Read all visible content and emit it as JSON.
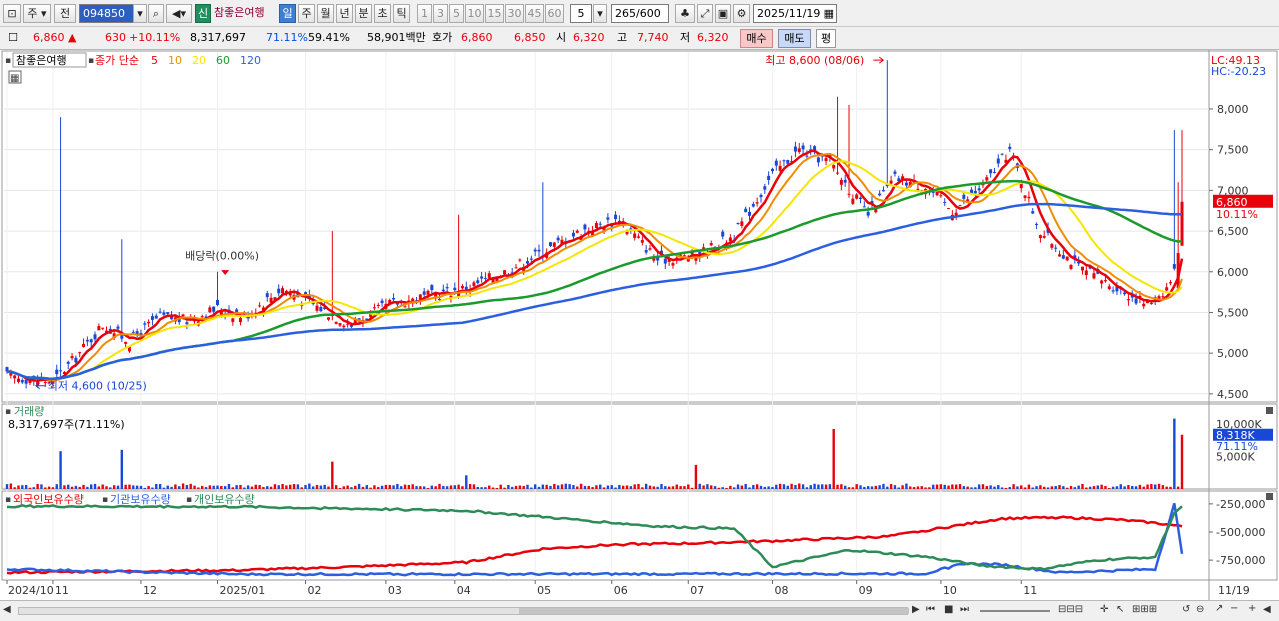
{
  "toolbar": {
    "market": "주",
    "prev_label": "전",
    "code": "094850",
    "shin": "신",
    "stock_name": "참좋은여행",
    "periods": [
      "일",
      "주",
      "월",
      "년",
      "분",
      "초",
      "틱"
    ],
    "selected_period": "일",
    "minutes": [
      "1",
      "3",
      "5",
      "10",
      "15",
      "30",
      "45",
      "60"
    ],
    "custom_minute": "5",
    "count": "265",
    "count_total": "/600",
    "date": "2025/11/19"
  },
  "quote": {
    "price": "6,860",
    "arrow": "▲",
    "change": "630",
    "change_pct": "+10.11%",
    "volume": "8,317,697",
    "vol_ratio": "71.11%",
    "turnover": "59.41%",
    "amount": "58,901백만",
    "hoga_label": "호가",
    "ask": "6,860",
    "bid": "6,850",
    "open_label": "시",
    "open": "6,320",
    "high_label": "고",
    "high": "7,740",
    "low_label": "저",
    "low": "6,320",
    "buy": "매수",
    "sell": "매도",
    "eval": "평"
  },
  "price_panel": {
    "title": "참좋은여행",
    "legend_prefix": "종가 단순",
    "ma": [
      {
        "period": "5",
        "color": "#e8000b"
      },
      {
        "period": "10",
        "color": "#f08c00"
      },
      {
        "period": "20",
        "color": "#f5e600"
      },
      {
        "period": "60",
        "color": "#1c9a2c"
      },
      {
        "period": "120",
        "color": "#2c5fe0"
      }
    ],
    "lc": "LC:49.13",
    "hc": "HC:-20.23",
    "y_ticks": [
      "8,000",
      "7,500",
      "7,000",
      "6,500",
      "6,000",
      "5,500",
      "5,000",
      "4,500"
    ],
    "current_price": "6,860",
    "current_pct": "10.11%",
    "annot_high": "최고 8,600 (08/06)",
    "annot_low": "최저 4,600 (10/25)",
    "annot_div": "배당락(0.00%)"
  },
  "volume_panel": {
    "title": "거래량",
    "value": "8,317,697주(71.11%)",
    "y_tick": "10,000K",
    "y_tick2": "5,000K",
    "current": "8,318K",
    "current_pct": "71.11%"
  },
  "holder_panel": {
    "series": [
      {
        "name": "외국인보유수량",
        "color": "#e8000b"
      },
      {
        "name": "기관보유수량",
        "color": "#2c5fe0"
      },
      {
        "name": "개인보유수량",
        "color": "#2e8b57"
      }
    ],
    "y_ticks": [
      "-250,000",
      "-500,000",
      "-750,000"
    ]
  },
  "x_axis": {
    "labels": [
      "2024/10",
      "11",
      "12",
      "2025/01",
      "02",
      "03",
      "04",
      "05",
      "06",
      "07",
      "08",
      "09",
      "10",
      "11"
    ],
    "end_label": "11/19"
  },
  "chart_data": [
    {
      "type": "candlestick",
      "title": "참좋은여행",
      "ylim": [
        4400,
        8700
      ],
      "x_start": "2024/10",
      "x_end": "2025/11/19",
      "keypoints": [
        [
          0,
          4720
        ],
        [
          12,
          4650
        ],
        [
          18,
          4950
        ],
        [
          25,
          5350
        ],
        [
          32,
          5150
        ],
        [
          40,
          5450
        ],
        [
          47,
          5400
        ],
        [
          55,
          5550
        ],
        [
          62,
          5450
        ],
        [
          72,
          5800
        ],
        [
          80,
          5600
        ],
        [
          90,
          5350
        ],
        [
          100,
          5600
        ],
        [
          110,
          5700
        ],
        [
          120,
          5800
        ],
        [
          130,
          6000
        ],
        [
          140,
          6250
        ],
        [
          150,
          6500
        ],
        [
          160,
          6650
        ],
        [
          170,
          6150
        ],
        [
          180,
          6200
        ],
        [
          190,
          6450
        ],
        [
          200,
          7200
        ],
        [
          207,
          7500
        ],
        [
          215,
          7350
        ],
        [
          225,
          6700
        ],
        [
          232,
          7150
        ],
        [
          240,
          7050
        ],
        [
          247,
          6750
        ],
        [
          255,
          7050
        ],
        [
          262,
          7500
        ],
        [
          270,
          6500
        ],
        [
          280,
          6050
        ],
        [
          290,
          5800
        ],
        [
          298,
          5600
        ],
        [
          303,
          5800
        ],
        [
          307,
          6200
        ]
      ],
      "high": 8600,
      "low": 4600,
      "last": 6860
    },
    {
      "type": "bar",
      "title": "거래량",
      "last": 8317697,
      "spikes": [
        [
          14,
          5800000
        ],
        [
          30,
          6000000
        ],
        [
          85,
          4200000
        ],
        [
          120,
          2100000
        ],
        [
          180,
          3700000
        ],
        [
          216,
          9200000
        ],
        [
          305,
          10800000
        ],
        [
          307,
          8300000
        ]
      ]
    },
    {
      "type": "line",
      "series": [
        {
          "name": "외국인보유수량",
          "keypoints": [
            [
              0,
              -860000
            ],
            [
              30,
              -850000
            ],
            [
              60,
              -840000
            ],
            [
              90,
              -810000
            ],
            [
              120,
              -770000
            ],
            [
              140,
              -650000
            ],
            [
              160,
              -610000
            ],
            [
              180,
              -600000
            ],
            [
              200,
              -580000
            ],
            [
              230,
              -540000
            ],
            [
              260,
              -380000
            ],
            [
              275,
              -370000
            ],
            [
              290,
              -390000
            ],
            [
              300,
              -420000
            ],
            [
              307,
              -450000
            ]
          ]
        },
        {
          "name": "기관보유수량",
          "keypoints": [
            [
              0,
              -830000
            ],
            [
              60,
              -875000
            ],
            [
              120,
              -875000
            ],
            [
              240,
              -870000
            ],
            [
              250,
              -780000
            ],
            [
              260,
              -790000
            ],
            [
              275,
              -860000
            ],
            [
              300,
              -830000
            ],
            [
              305,
              -250000
            ],
            [
              307,
              -700000
            ]
          ]
        },
        {
          "name": "개인보유수량",
          "keypoints": [
            [
              0,
              -270000
            ],
            [
              60,
              -275000
            ],
            [
              120,
              -310000
            ],
            [
              170,
              -450000
            ],
            [
              190,
              -470000
            ],
            [
              200,
              -810000
            ],
            [
              220,
              -660000
            ],
            [
              240,
              -720000
            ],
            [
              255,
              -800000
            ],
            [
              270,
              -830000
            ],
            [
              285,
              -750000
            ],
            [
              300,
              -720000
            ],
            [
              305,
              -330000
            ],
            [
              307,
              -280000
            ]
          ]
        }
      ]
    }
  ]
}
